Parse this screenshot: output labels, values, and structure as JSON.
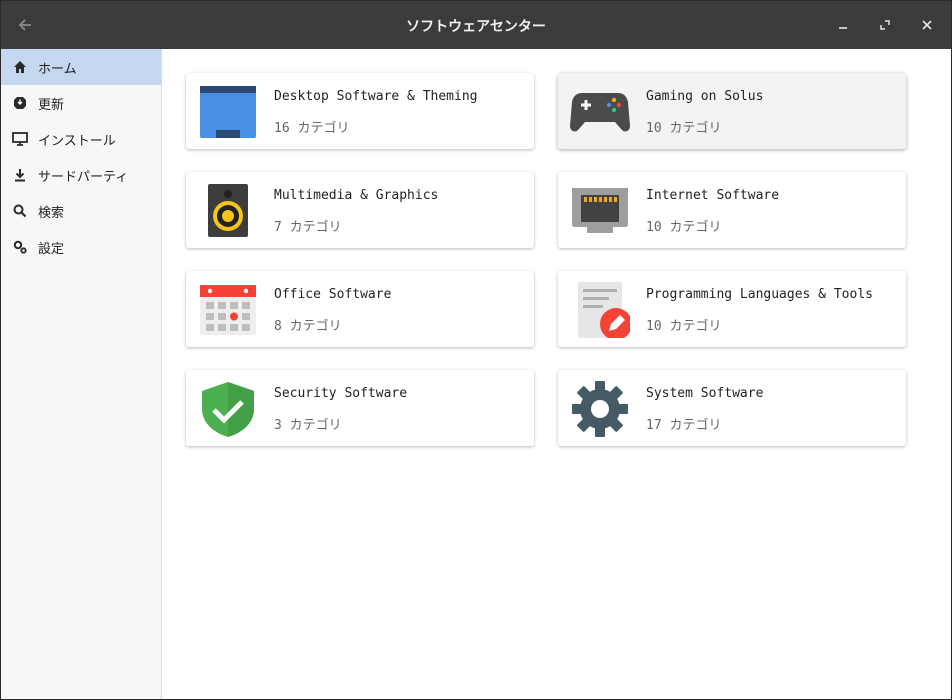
{
  "window": {
    "title": "ソフトウェアセンター"
  },
  "sidebar": {
    "items": [
      {
        "label": "ホーム",
        "icon": "home-icon",
        "active": true
      },
      {
        "label": "更新",
        "icon": "update-icon"
      },
      {
        "label": "インストール",
        "icon": "monitor-icon"
      },
      {
        "label": "サードパーティ",
        "icon": "download-icon"
      },
      {
        "label": "検索",
        "icon": "search-icon"
      },
      {
        "label": "設定",
        "icon": "settings-icon"
      }
    ]
  },
  "categories": [
    {
      "name": "Desktop Software & Theming",
      "count": "16 カテゴリ",
      "icon": "desktop-icon"
    },
    {
      "name": "Gaming on Solus",
      "count": "10 カテゴリ",
      "icon": "gamepad-icon"
    },
    {
      "name": "Multimedia & Graphics",
      "count": "7 カテゴリ",
      "icon": "speaker-icon"
    },
    {
      "name": "Internet Software",
      "count": "10 カテゴリ",
      "icon": "ethernet-icon"
    },
    {
      "name": "Office Software",
      "count": "8 カテゴリ",
      "icon": "calendar-icon"
    },
    {
      "name": "Programming Languages & Tools",
      "count": "10 カテゴリ",
      "icon": "code-edit-icon"
    },
    {
      "name": "Security Software",
      "count": "3 カテゴリ",
      "icon": "shield-check-icon"
    },
    {
      "name": "System Software",
      "count": "17 カテゴリ",
      "icon": "gear-icon"
    }
  ],
  "colors": {
    "titlebar": "#3b3b3b",
    "sidebar_active": "#c5d6ef",
    "accent_blue": "#4a90e2"
  }
}
